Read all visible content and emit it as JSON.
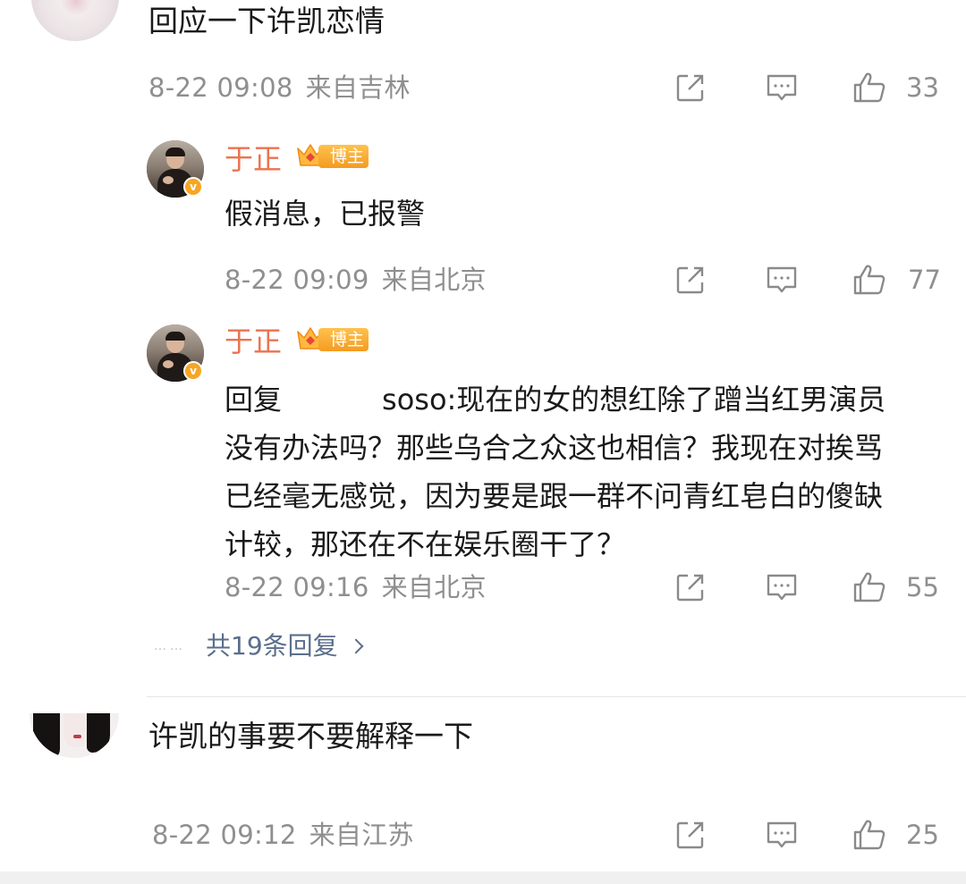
{
  "comments": [
    {
      "text": "回应一下许凯恋情",
      "time": "8-22 09:08",
      "location": "来自吉林",
      "likes": "33",
      "replies": [
        {
          "user": "于正",
          "badge": "博主",
          "text": "假消息，已报警",
          "time": "8-22 09:09",
          "location": "来自北京",
          "likes": "77"
        },
        {
          "user": "于正",
          "badge": "博主",
          "reply_prefix": "回复",
          "reply_target_suffix": "soso",
          "lines": [
            ":现在的女的想红除了蹭当红男演员",
            "没有办法吗？那些乌合之众这也相信？我现在对挨骂",
            "已经毫无感觉，因为要是跟一群不问青红皂白的傻缺",
            "计较，那还在不在娱乐圈干了？"
          ],
          "time": "8-22 09:16",
          "location": "来自北京",
          "likes": "55"
        }
      ],
      "more_dots": "……",
      "more_replies": "共19条回复"
    },
    {
      "text": "许凯的事要不要解释一下",
      "time": "8-22 09:12",
      "location": "来自江苏",
      "likes": "25"
    }
  ],
  "icons": {
    "repost": "repost-icon",
    "comment": "comment-icon",
    "like": "thumbs-up-icon",
    "verified": "verified-v-icon",
    "crown": "crown-icon",
    "chevron": "chevron-right-icon"
  },
  "colors": {
    "username": "#eb7350",
    "meta": "#8f8f8f",
    "link": "#5a6e8c",
    "badge": "#f49b22"
  },
  "verified_mark": "v"
}
